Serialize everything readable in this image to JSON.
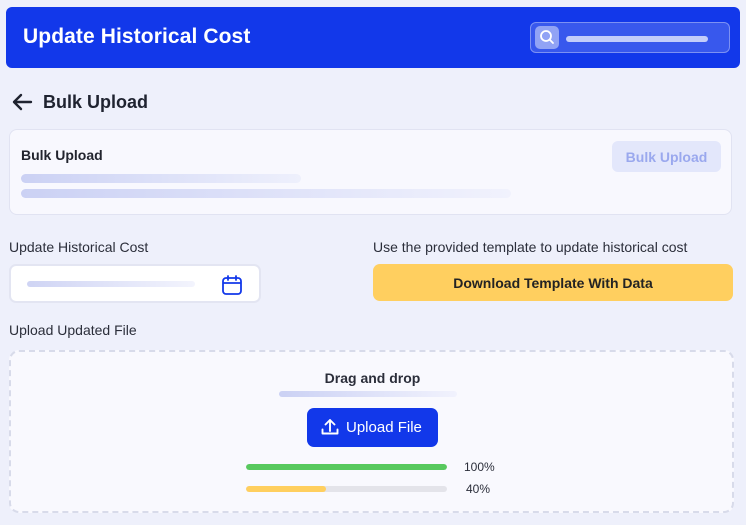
{
  "header": {
    "title": "Update Historical Cost",
    "search_icon": "search-icon"
  },
  "page": {
    "back_icon": "arrow-left-icon",
    "title": "Bulk Upload"
  },
  "card": {
    "title": "Bulk Upload",
    "button_label": "Bulk Upload"
  },
  "form": {
    "date_label": "Update Historical Cost",
    "date_icon": "calendar-icon",
    "template_hint": "Use the provided template to update historical cost",
    "download_label": "Download Template With Data",
    "upload_label": "Upload Updated File"
  },
  "dropzone": {
    "title": "Drag and drop",
    "upload_button": "Upload File",
    "upload_icon": "upload-icon",
    "progress": [
      {
        "percent_label": "100%",
        "value": 1.0,
        "color": "#58c95e"
      },
      {
        "percent_label": "40%",
        "value": 0.4,
        "color": "#ffcf5f"
      }
    ]
  },
  "colors": {
    "primary": "#1238ea",
    "accent": "#ffcf5f",
    "success": "#58c95e",
    "background": "#eef0fb"
  }
}
